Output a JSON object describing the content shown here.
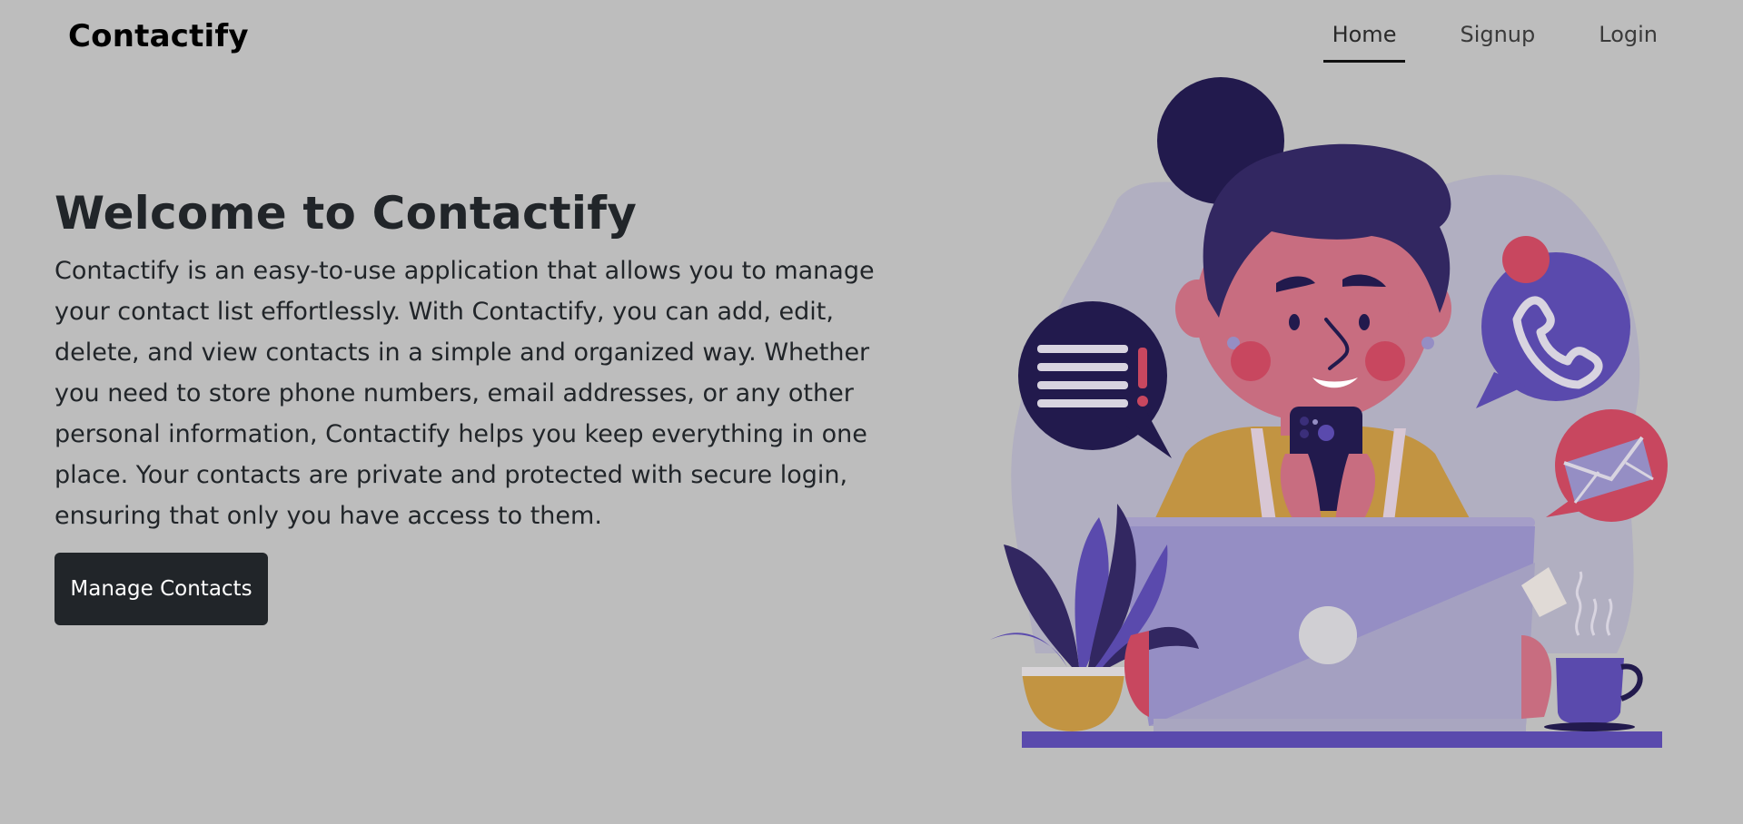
{
  "nav": {
    "brand": "Contactify",
    "links": [
      {
        "label": "Home",
        "active": true
      },
      {
        "label": "Signup",
        "active": false
      },
      {
        "label": "Login",
        "active": false
      }
    ]
  },
  "hero": {
    "title": "Welcome to Contactify",
    "description": "Contactify is an easy-to-use application that allows you to manage your contact list effortlessly. With Contactify, you can add, edit, delete, and view contacts in a simple and organized way. Whether you need to store phone numbers, email addresses, or any other personal information, Contactify helps you keep everything in one place. Your contacts are private and protected with secure login, ensuring that only you have access to them.",
    "cta_label": "Manage Contacts"
  },
  "colors": {
    "background": "#bdbdbd",
    "text": "#212529",
    "button": "#212529",
    "illustration_purple": "#5a4aad",
    "illustration_navy": "#221a4d",
    "illustration_pink": "#c8475f",
    "illustration_mustard": "#c29442",
    "illustration_lavender": "#958ec4"
  },
  "icons": [
    "chat-bubble-icon",
    "phone-bubble-icon",
    "mail-bubble-icon"
  ]
}
